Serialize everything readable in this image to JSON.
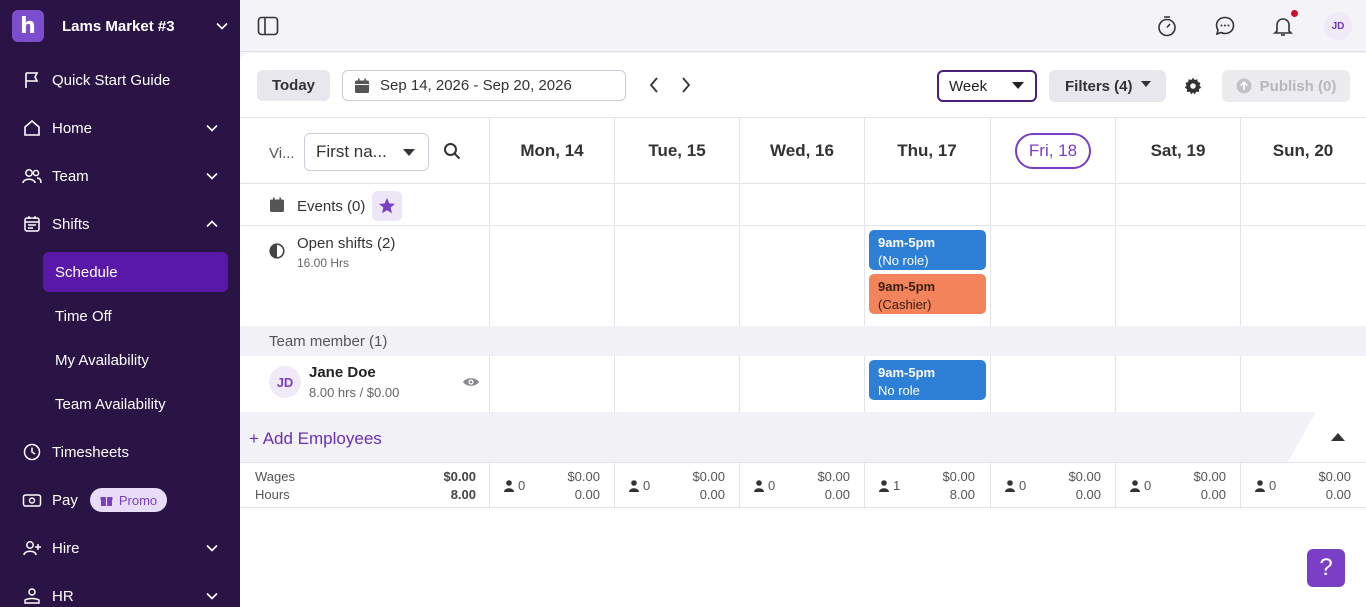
{
  "brand": {
    "logo_letter": "h",
    "name": "Lams Market #3"
  },
  "sidebar": {
    "quick_start": "Quick Start Guide",
    "home": "Home",
    "team": "Team",
    "shifts": "Shifts",
    "shifts_sub": [
      "Schedule",
      "Time Off",
      "My Availability",
      "Team Availability"
    ],
    "timesheets": "Timesheets",
    "pay": "Pay",
    "promo": "Promo",
    "hire": "Hire",
    "hr": "HR"
  },
  "topbar": {
    "avatar_initials": "JD"
  },
  "toolbar": {
    "today": "Today",
    "date_range": "Sep 14, 2026 - Sep 20, 2026",
    "view_select": "Week",
    "filters": "Filters (4)",
    "publish": "Publish (0)"
  },
  "grid": {
    "view_label": "Vi...",
    "sort_select": "First na...",
    "days": [
      "Mon, 14",
      "Tue, 15",
      "Wed, 16",
      "Thu, 17",
      "Fri, 18",
      "Sat, 19",
      "Sun, 20"
    ],
    "today_index": 4,
    "events_label": "Events (0)",
    "open_shifts_label": "Open shifts (2)",
    "open_shifts_hours": "16.00 Hrs",
    "open_shifts": [
      {
        "time": "9am-5pm",
        "role": "(No role)",
        "color": "#2e7fd6"
      },
      {
        "time": "9am-5pm",
        "role": "(Cashier)",
        "color": "#f2835a"
      }
    ],
    "team_section": "Team member (1)",
    "member": {
      "initials": "JD",
      "name": "Jane Doe",
      "summary": "8.00 hrs / $0.00",
      "shift": {
        "time": "9am-5pm",
        "role": "No role"
      }
    },
    "add_employees": "+ Add Employees"
  },
  "totals": {
    "wages_label": "Wages",
    "hours_label": "Hours",
    "wages_total": "$0.00",
    "hours_total": "8.00",
    "days": [
      {
        "count": "0",
        "wages": "$0.00",
        "hours": "0.00"
      },
      {
        "count": "0",
        "wages": "$0.00",
        "hours": "0.00"
      },
      {
        "count": "0",
        "wages": "$0.00",
        "hours": "0.00"
      },
      {
        "count": "1",
        "wages": "$0.00",
        "hours": "8.00"
      },
      {
        "count": "0",
        "wages": "$0.00",
        "hours": "0.00"
      },
      {
        "count": "0",
        "wages": "$0.00",
        "hours": "0.00"
      },
      {
        "count": "0",
        "wages": "$0.00",
        "hours": "0.00"
      }
    ]
  },
  "help": "?"
}
